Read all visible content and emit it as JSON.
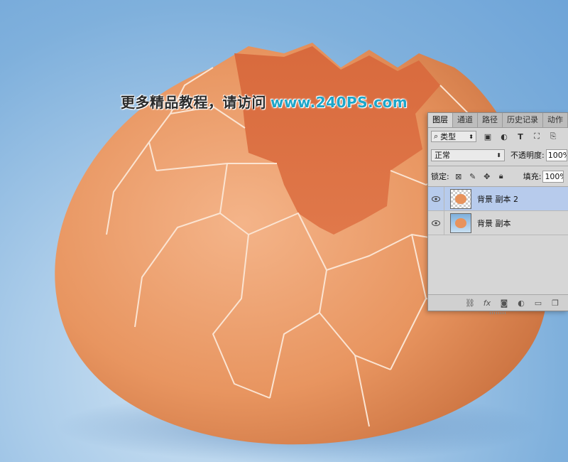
{
  "watermark": {
    "text_cn": "更多精品教程，请访问",
    "url": "www.240PS.com"
  },
  "colors": {
    "background": "#7fb0dc",
    "egg_shell": "#e8955f",
    "egg_inner": "#d9693c",
    "watermark_url": "#1fa6c9",
    "selected_layer": "#b7cbec"
  },
  "layers_panel": {
    "tabs": [
      "图层",
      "通道",
      "路径",
      "历史记录",
      "动作"
    ],
    "active_tab": "图层",
    "filter": {
      "label": "类型",
      "icons": [
        "image-filter-icon",
        "adjustment-filter-icon",
        "type-filter-icon",
        "shape-filter-icon",
        "smart-object-filter-icon"
      ]
    },
    "blend_mode": "正常",
    "opacity_label": "不透明度:",
    "opacity_value": "100%",
    "lock_label": "锁定:",
    "fill_label": "填充:",
    "fill_value": "100%",
    "layers": [
      {
        "name": "背景 副本 2",
        "visible": true,
        "selected": true,
        "thumbnail": "transparent-egg"
      },
      {
        "name": "背景 副本",
        "visible": true,
        "selected": false,
        "thumbnail": "egg-on-blue"
      }
    ],
    "bottom_icons": [
      "link-layers-icon",
      "fx-icon",
      "add-mask-icon",
      "adjustment-layer-icon",
      "new-group-icon",
      "new-layer-icon"
    ]
  }
}
